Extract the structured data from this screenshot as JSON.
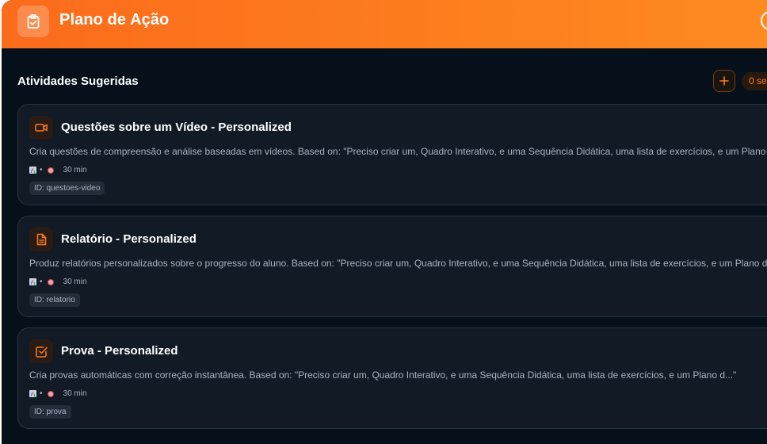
{
  "header": {
    "title": "Plano de Ação",
    "icon": "clipboard-check-icon",
    "accent": "#fb7b1e"
  },
  "main": {
    "section_title": "Atividades Sugeridas",
    "add_button_label": "+",
    "selected_count": "0 se"
  },
  "cards": [
    {
      "icon": "video-icon",
      "title": "Questões sobre um Vídeo - Personalized",
      "description": "Cria questões de compreensão e análise baseadas em vídeos. Based on: \"Preciso criar um, Quadro Interativo, e uma Sequência Didática, uma lista de exercícios, e um Plano d...\"",
      "duration": "30 min",
      "id": "ID: questoes-video"
    },
    {
      "icon": "document-icon",
      "title": "Relatório - Personalized",
      "description": "Produz relatórios personalizados sobre o progresso do aluno. Based on: \"Preciso criar um, Quadro Interativo, e uma Sequência Didática, uma lista de exercícios, e um Plano d...\"",
      "duration": "30 min",
      "id": "ID: relatorio"
    },
    {
      "icon": "checkbox-icon",
      "title": "Prova - Personalized",
      "description": "Cria provas automáticas com correção instantânea. Based on: \"Preciso criar um, Quadro Interativo, e uma Sequência Didática, uma lista de exercícios, e um Plano d...\"",
      "duration": "30 min",
      "id": "ID: prova"
    }
  ]
}
